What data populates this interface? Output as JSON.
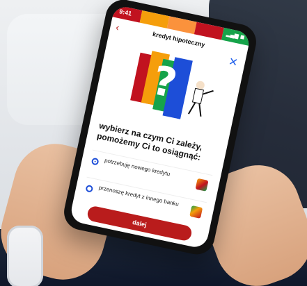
{
  "status": {
    "time": "9:41",
    "signal": ""
  },
  "nav": {
    "back_symbol": "‹",
    "title": "kredyt hipoteczny",
    "close_symbol": "✕"
  },
  "headline": "wybierz na czym Ci zależy, pomożemy Ci to osiągnąć:",
  "options": [
    {
      "label": "potrzebuję nowego kredytu",
      "selected": true,
      "icon": "house-person-icon"
    },
    {
      "label": "przenoszę kredyt z innego banku",
      "selected": false,
      "icon": "transfer-icon"
    }
  ],
  "cta": {
    "label": "dalej"
  },
  "colors": {
    "statusbar": [
      "#c1121f",
      "#f59e0b",
      "#fb923c",
      "#c1121f",
      "#16a34a"
    ],
    "accent_red": "#b91c1c",
    "link_blue": "#2563eb"
  }
}
